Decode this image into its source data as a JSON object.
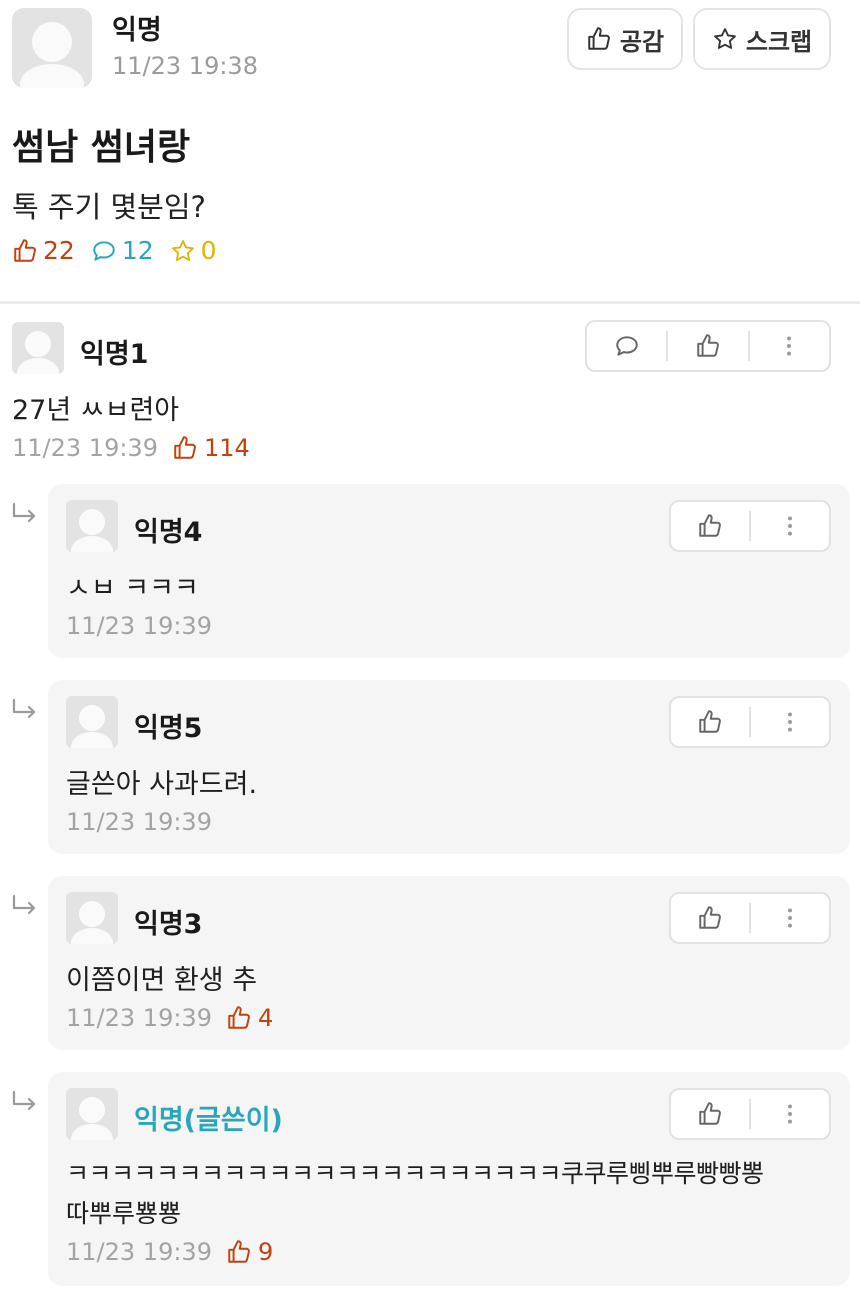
{
  "post": {
    "author": "익명",
    "time": "11/23 19:38",
    "title": "썸남 썸녀랑",
    "body": "톡 주기 몇분임?",
    "likes": "22",
    "comments": "12",
    "scraps": "0",
    "buttons": {
      "like_label": "공감",
      "scrap_label": "스크랩"
    }
  },
  "comments": [
    {
      "author": "익명1",
      "text": "27년 ㅆㅂ련아",
      "time": "11/23 19:39",
      "likes": "114"
    }
  ],
  "replies": [
    {
      "author": "익명4",
      "text": "ㅅㅂ ㅋㅋㅋ",
      "time": "11/23 19:39"
    },
    {
      "author": "익명5",
      "text": "글쓴아 사과드려.",
      "time": "11/23 19:39"
    },
    {
      "author": "익명3",
      "text": "이쯤이면 환생 추",
      "time": "11/23 19:39",
      "likes": "4"
    },
    {
      "author": "익명(글쓴이)",
      "text_line1": "ㅋㅋㅋㅋㅋㅋㅋㅋㅋㅋㅋㅋㅋㅋㅋㅋㅋㅋㅋㅋㅋㅋ쿠쿠루삥뿌루빵빵뽕",
      "text_line2": "따뿌루뿅뿅",
      "time": "11/23 19:39",
      "likes": "9"
    }
  ],
  "icons": {
    "like": "thumbs-up-icon",
    "comment": "speech-bubble-icon",
    "scrap": "star-icon",
    "more": "more-vertical-icon",
    "reply": "reply-arrow-icon",
    "avatar": "default-avatar"
  },
  "colors": {
    "like": "#c2410c",
    "comment": "#29a7b8",
    "scrap": "#e0b400",
    "op_name": "#29a7b8"
  }
}
